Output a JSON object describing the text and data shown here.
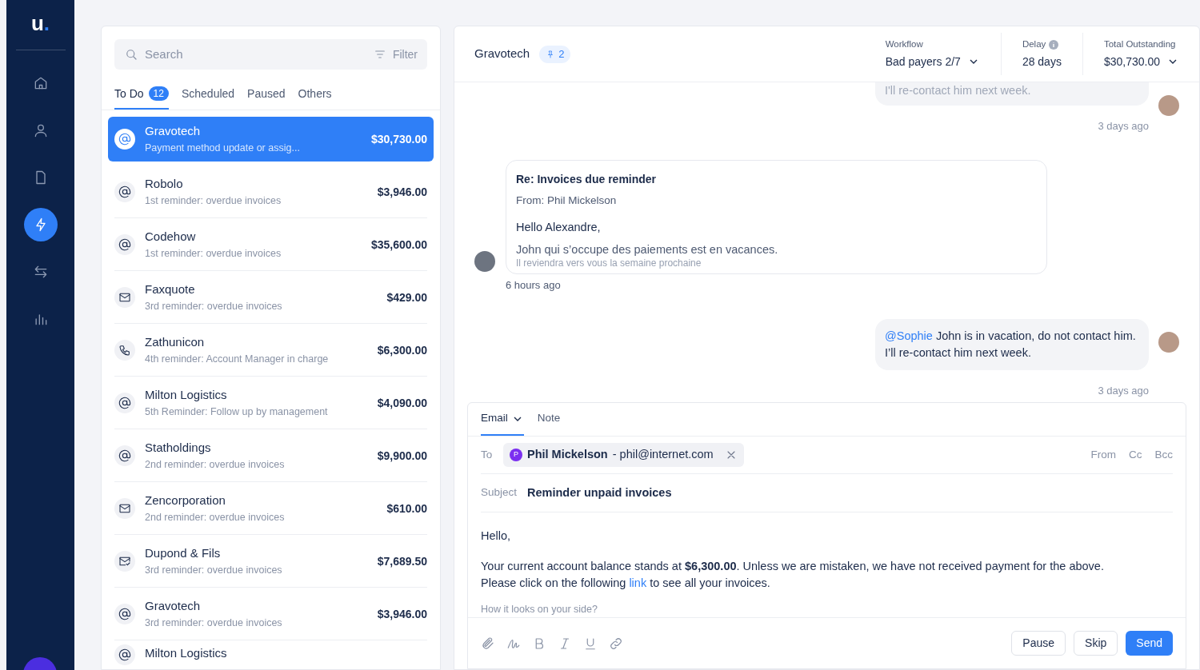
{
  "sidebar": {
    "logo": {
      "text": "u",
      "dot": "."
    },
    "nav": [
      {
        "selected": false
      },
      {
        "selected": false
      },
      {
        "selected": false
      },
      {
        "selected": true
      },
      {
        "selected": false
      },
      {
        "selected": false
      }
    ]
  },
  "list_panel": {
    "search": {
      "placeholder": "Search"
    },
    "filter": "Filter",
    "tabs": [
      {
        "label": "To Do",
        "count": "12",
        "selected": true
      },
      {
        "label": "Scheduled",
        "selected": false
      },
      {
        "label": "Paused",
        "selected": false
      },
      {
        "label": "Others",
        "selected": false
      }
    ],
    "items": [
      {
        "kind": "email",
        "name": "Gravotech",
        "subtitle": "Payment method update or assig...",
        "amount": "$30,730.00",
        "selected": true
      },
      {
        "kind": "email",
        "name": "Robolo",
        "subtitle": "1st reminder: overdue invoices",
        "amount": "$3,946.00",
        "selected": false
      },
      {
        "kind": "email",
        "name": "Codehow",
        "subtitle": "1st reminder: overdue invoices",
        "amount": "$35,600.00",
        "selected": false
      },
      {
        "kind": "letter",
        "name": "Faxquote",
        "subtitle": "3rd reminder: overdue invoices",
        "amount": "$429.00",
        "selected": false
      },
      {
        "kind": "phone",
        "name": "Zathunicon",
        "subtitle": "4th reminder: Account Manager in charge",
        "amount": "$6,300.00",
        "selected": false
      },
      {
        "kind": "email",
        "name": "Milton Logistics",
        "subtitle": "5th Reminder: Follow up by management",
        "amount": "$4,090.00",
        "selected": false
      },
      {
        "kind": "email",
        "name": "Statholdings",
        "subtitle": "2nd reminder: overdue invoices",
        "amount": "$9,900.00",
        "selected": false
      },
      {
        "kind": "letter",
        "name": "Zencorporation",
        "subtitle": "2nd reminder: overdue invoices",
        "amount": "$610.00",
        "selected": false
      },
      {
        "kind": "letter-check",
        "name": "Dupond & Fils",
        "subtitle": "3rd reminder: overdue invoices",
        "amount": "$7,689.50",
        "selected": false
      },
      {
        "kind": "email",
        "name": "Gravotech",
        "subtitle": "3rd reminder: overdue invoices",
        "amount": "$3,946.00",
        "selected": false
      },
      {
        "kind": "email",
        "name": "Milton Logistics"
      }
    ]
  },
  "detail": {
    "header": {
      "title": "Gravotech",
      "pin_count": "2",
      "stats": [
        {
          "label": "Workflow",
          "value": "Bad payers 2/7",
          "dropdown": true,
          "info": false
        },
        {
          "label": "Delay",
          "value": "28 days",
          "dropdown": false,
          "info": true
        },
        {
          "label": "Total Outstanding",
          "value": "$30,730.00",
          "dropdown": true,
          "info": false
        }
      ]
    },
    "messages": [
      {
        "kind": "note",
        "lines": [
          "I'll re-contact him next week."
        ],
        "time": "3 days ago"
      },
      {
        "kind": "email",
        "subject": "Re: Invoices due reminder",
        "from": "From: Phil Mickelson",
        "greeting": "Hello Alexandre,",
        "lines": [
          "John qui s’occupe des paiements est en vacances.",
          "Il reviendra vers vous la semaine prochaine"
        ],
        "time": "6 hours ago"
      },
      {
        "kind": "note",
        "mention": "@Sophie",
        "lines": [
          "John is in vacation, do not contact him.",
          "I’ll re-contact him next week."
        ],
        "time": "3 days ago"
      }
    ],
    "composer": {
      "tabs": [
        {
          "label": "Email",
          "selected": true,
          "dropdown": true
        },
        {
          "label": "Note",
          "selected": false,
          "dropdown": false
        }
      ],
      "to_label": "To",
      "recipient": {
        "initial": "P",
        "name": "Phil Mickelson",
        "email": "- phil@internet.com"
      },
      "header_links": [
        "From",
        "Cc",
        "Bcc"
      ],
      "subject_label": "Subject",
      "subject": "Reminder unpaid invoices",
      "body": {
        "greeting": "Hello,",
        "line1": "Your current account balance stands at **$6,300.00**. Unless we are mistaken, we have not received payment for the above.",
        "line2_before": "Please click on the following",
        "link": "link",
        "line2_after": "to see all your invoices.",
        "line3": "How it looks on your side?"
      },
      "buttons": [
        {
          "label": "Pause",
          "kind": "secondary"
        },
        {
          "label": "Skip",
          "kind": "secondary"
        },
        {
          "label": "Send",
          "kind": "primary"
        }
      ]
    }
  }
}
